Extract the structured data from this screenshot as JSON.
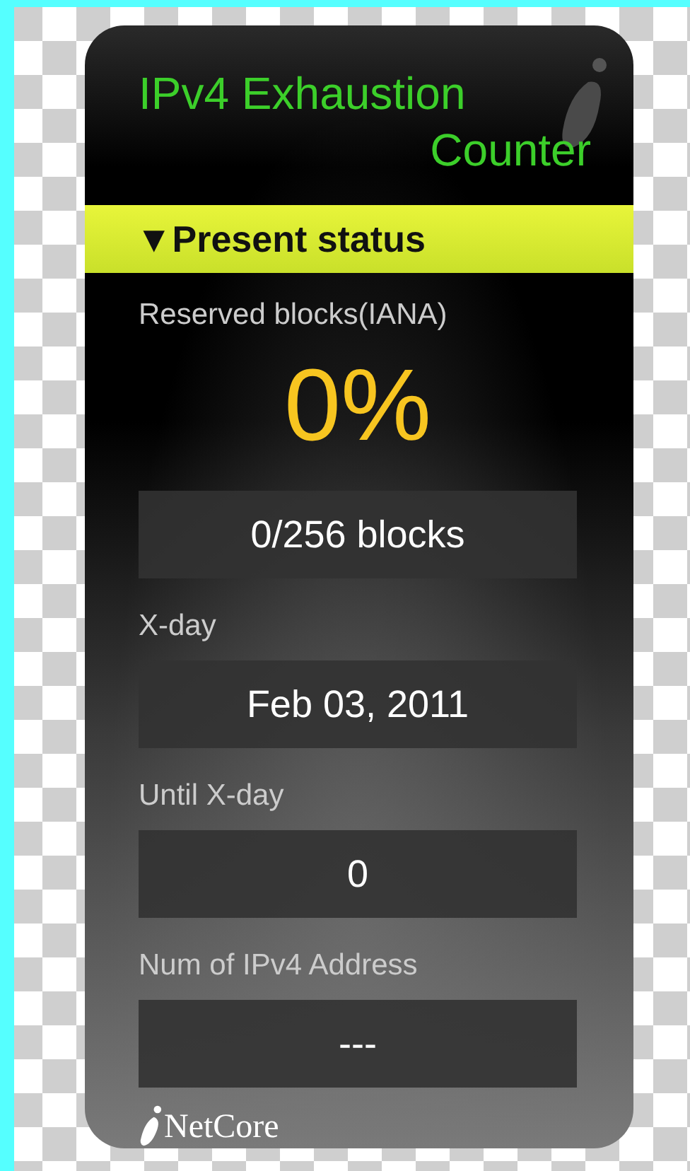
{
  "widget": {
    "title_lines": [
      "IPv4 Exhaustion",
      "Counter"
    ],
    "section_header": "▼Present status",
    "fields": [
      {
        "label": "Reserved blocks(IANA)",
        "percent": "0%",
        "value": "0/256 blocks"
      },
      {
        "label": "X-day",
        "value": "Feb 03, 2011"
      },
      {
        "label": "Until X-day",
        "value": "0"
      },
      {
        "label": "Num of IPv4 Address",
        "value": "---"
      }
    ],
    "logo": "NetCore"
  }
}
